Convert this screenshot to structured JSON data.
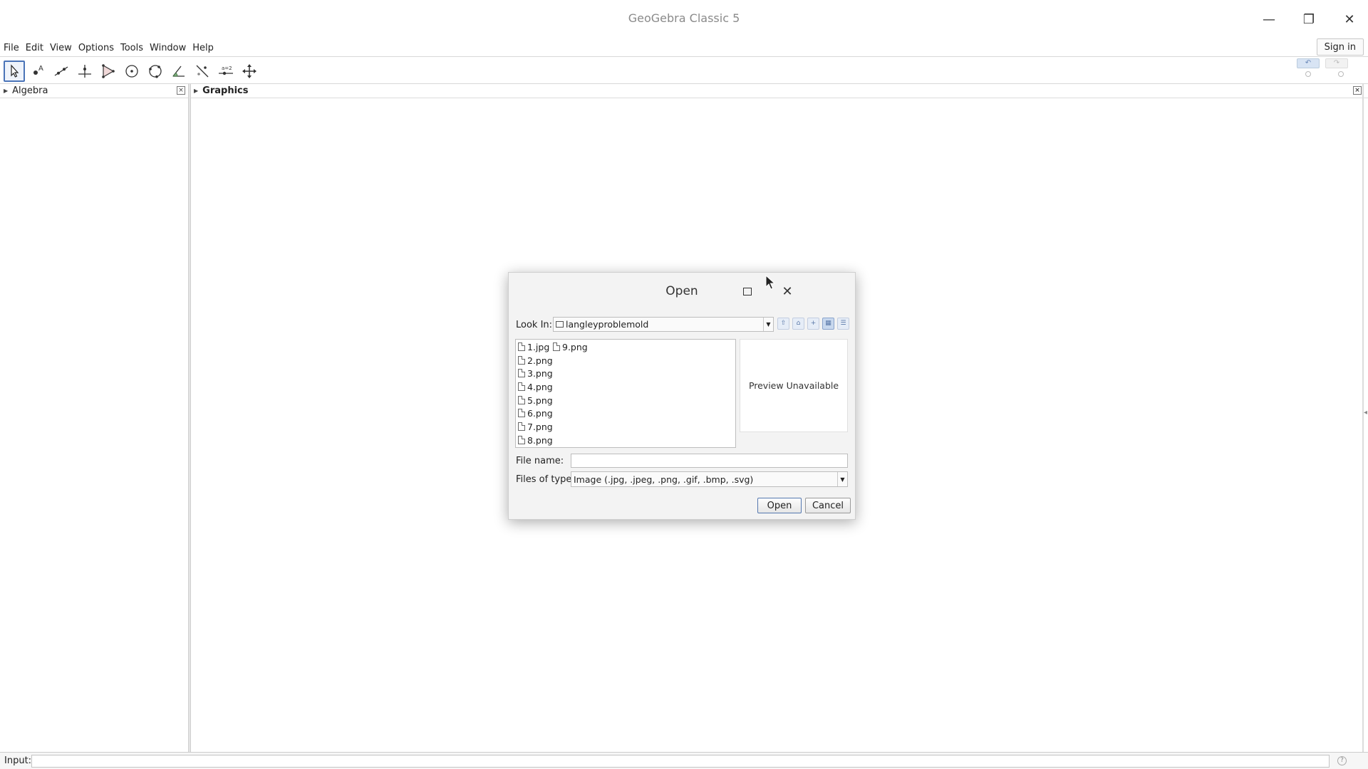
{
  "window": {
    "title": "GeoGebra Classic 5",
    "minimize_glyph": "—",
    "restore_glyph": "❐",
    "close_glyph": "✕"
  },
  "menubar": {
    "items": [
      "File",
      "Edit",
      "View",
      "Options",
      "Tools",
      "Window",
      "Help"
    ],
    "signin_label": "Sign in"
  },
  "toolbar": {
    "tools": [
      {
        "name": "move-tool-icon",
        "active": true
      },
      {
        "name": "point-tool-icon",
        "active": false
      },
      {
        "name": "line-tool-icon",
        "active": false
      },
      {
        "name": "perpendicular-line-tool-icon",
        "active": false
      },
      {
        "name": "polygon-tool-icon",
        "active": false
      },
      {
        "name": "circle-center-point-tool-icon",
        "active": false
      },
      {
        "name": "circle-three-points-tool-icon",
        "active": false
      },
      {
        "name": "angle-tool-icon",
        "active": false
      },
      {
        "name": "reflect-tool-icon",
        "active": false
      },
      {
        "name": "slider-tool-icon",
        "active": false
      },
      {
        "name": "move-graphics-view-tool-icon",
        "active": false
      }
    ],
    "slider_label": "a=2"
  },
  "panels": {
    "algebra_title": "Algebra",
    "graphics_title": "Graphics"
  },
  "inputbar": {
    "label": "Input:",
    "value": ""
  },
  "dialog": {
    "title": "Open",
    "look_in_label": "Look In:",
    "look_in_value": "langleyproblemold",
    "files": [
      "1.jpg",
      "2.png",
      "3.png",
      "4.png",
      "5.png",
      "6.png",
      "7.png",
      "8.png",
      "9.png"
    ],
    "preview_text": "Preview Unavailable",
    "file_name_label": "File name:",
    "file_name_value": "",
    "files_of_type_label": "Files of type:",
    "files_of_type_value": "Image (.jpg, .jpeg, .png, .gif, .bmp, .svg)",
    "open_button": "Open",
    "cancel_button": "Cancel"
  }
}
